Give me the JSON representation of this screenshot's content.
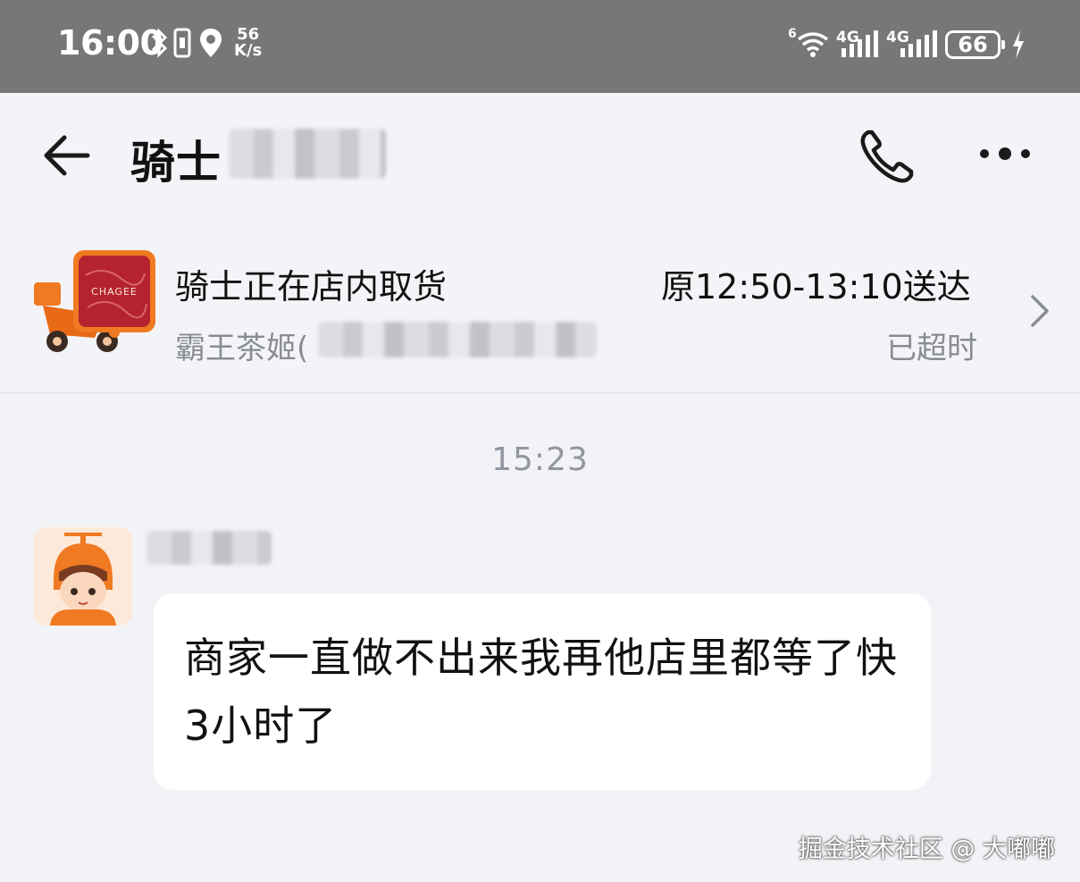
{
  "status_bar": {
    "time": "16:00",
    "speed_value": "56",
    "speed_unit": "K/s",
    "wifi_label": "6",
    "net1": "4G",
    "net2": "4G",
    "battery": "66",
    "icons": [
      "bluetooth-icon",
      "vibrate-icon",
      "location-icon",
      "wifi-icon",
      "signal-icon",
      "signal-icon",
      "battery-icon",
      "charging-icon"
    ]
  },
  "header": {
    "title": "骑士",
    "icons": [
      "back-arrow-icon",
      "phone-icon",
      "more-icon"
    ]
  },
  "order": {
    "status": "骑士正在店内取货",
    "shop": "霸王茶姬(",
    "eta": "原12:50-13:10送达",
    "late": "已超时",
    "brand_text": "CHAGEE",
    "accent": "#f07a22",
    "brand_red": "#b5242e"
  },
  "chat": {
    "timestamp": "15:23",
    "message": "商家一直做不出来我再他店里都等了快3小时了"
  },
  "watermark": "掘金技术社区 @ 大嘟嘟"
}
